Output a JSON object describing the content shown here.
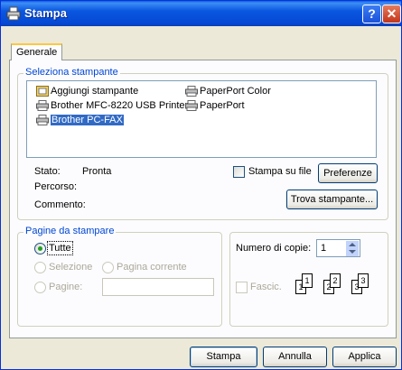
{
  "window": {
    "title": "Stampa"
  },
  "tabs": [
    {
      "label": "Generale"
    }
  ],
  "select_printer": {
    "legend": "Seleziona stampante",
    "items": [
      {
        "label": "Aggiungi stampante",
        "icon": "add-printer-icon"
      },
      {
        "label": "PaperPort Color",
        "icon": "printer-icon"
      },
      {
        "label": "Brother MFC-8220 USB Printer",
        "icon": "printer-icon"
      },
      {
        "label": "PaperPort",
        "icon": "printer-icon"
      },
      {
        "label": "Brother PC-FAX",
        "icon": "printer-icon",
        "selected": true
      }
    ],
    "status_label": "Stato:",
    "status_value": "Pronta",
    "location_label": "Percorso:",
    "comment_label": "Commento:",
    "print_to_file_label": "Stampa su file",
    "preferences_button": "Preferenze",
    "find_printer_button": "Trova stampante..."
  },
  "page_range": {
    "legend": "Pagine da stampare",
    "all_label": "Tutte",
    "selection_label": "Selezione",
    "current_page_label": "Pagina corrente",
    "pages_label": "Pagine:",
    "pages_value": ""
  },
  "copies": {
    "number_label": "Numero di copie:",
    "number_value": "1",
    "collate_label": "Fascic.",
    "collate_pages": [
      "1",
      "1",
      "2",
      "2",
      "3",
      "3"
    ]
  },
  "footer": {
    "print_button": "Stampa",
    "cancel_button": "Annulla",
    "apply_button": "Applica"
  },
  "colors": {
    "titlebar": "#0a57e0",
    "legend_text": "#0046d5",
    "selection": "#316ac5",
    "radio_dot": "#21a121"
  }
}
